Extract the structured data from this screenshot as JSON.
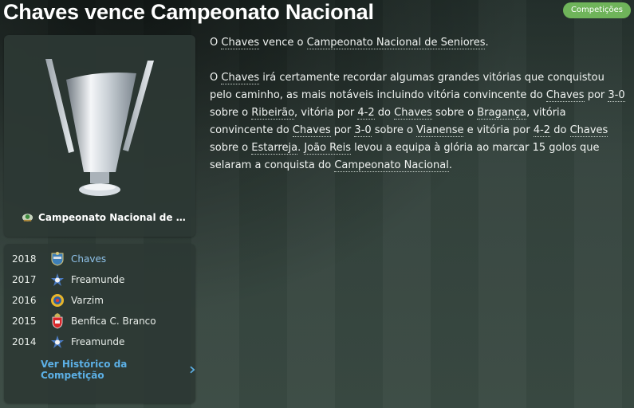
{
  "header": {
    "title": "Chaves vence Campeonato Nacional",
    "tag": "Competições"
  },
  "competition": {
    "name": "Campeonato Nacional de Seniores",
    "name_display": "Campeonato Nacional de Se..."
  },
  "winners": [
    {
      "year": "2018",
      "team": "Chaves",
      "crest": "chaves-crest",
      "highlight": true
    },
    {
      "year": "2017",
      "team": "Freamunde",
      "crest": "freamunde-crest",
      "highlight": false
    },
    {
      "year": "2016",
      "team": "Varzim",
      "crest": "varzim-crest",
      "highlight": false
    },
    {
      "year": "2015",
      "team": "Benfica C. Branco",
      "crest": "benfica-crest",
      "highlight": false
    },
    {
      "year": "2014",
      "team": "Freamunde",
      "crest": "freamunde-crest",
      "highlight": false
    }
  ],
  "history_link": "Ver Histórico da Competição",
  "article": {
    "p1": {
      "t1": "O ",
      "chaves": "Chaves",
      "t2": " vence o ",
      "comp": "Campeonato Nacional de Seniores",
      "t3": "."
    },
    "p2": {
      "t1": "O ",
      "chaves1": "Chaves",
      "t2": " irá certamente recordar algumas grandes vitórias que conquistou pelo caminho, as mais notáveis incluindo vitória convincente do ",
      "chaves2": "Chaves",
      "t3": " por ",
      "score1": "3-0",
      "t4": " sobre o ",
      "team1": "Ribeirão",
      "t5": ", vitória por ",
      "score2": "4-2",
      "t6": " do ",
      "chaves3": "Chaves",
      "t7": " sobre o ",
      "team2": "Bragança",
      "t8": ", vitória convincente do ",
      "chaves4": "Chaves",
      "t9": " por ",
      "score3": "3-0",
      "t10": " sobre o ",
      "team3": "Vianense",
      "t11": " e vitória por ",
      "score4": "4-2",
      "t12": " do ",
      "chaves5": "Chaves",
      "t13": " sobre o ",
      "team4": "Estarreja",
      "t14": ". ",
      "player": "João Reis",
      "t15": " levou a equipa à glória ao marcar 15 golos que selaram a conquista do ",
      "comp": "Campeonato Nacional",
      "t16": "."
    }
  },
  "colors": {
    "tag": "#6fb45a",
    "link": "#5cb0e6",
    "highlight_team": "#8fc2ea"
  }
}
